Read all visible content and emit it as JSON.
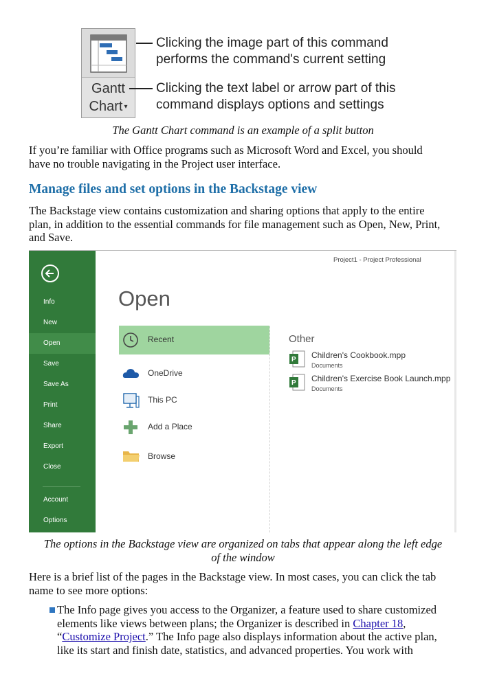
{
  "figure1": {
    "button_label_top": "Gantt",
    "button_label_bottom": "Chart",
    "callout1_line1": "Clicking the image part of this command",
    "callout1_line2": "performs the command's current setting",
    "callout2_line1": "Clicking the text label or arrow part of this",
    "callout2_line2": "command displays options and settings",
    "caption": "The Gantt Chart command is an example of a split button"
  },
  "intro": {
    "line1": "If you’re familiar with Office programs such as Microsoft Word and Excel, you should",
    "line2": "have no trouble navigating in the Project user interface."
  },
  "section": {
    "heading": "Manage files and set options in the Backstage view",
    "p_line1": "The Backstage view contains customization and sharing options that apply to the entire",
    "p_line2": "plan, in addition to the essential commands for file management such as Open, New, Print,",
    "p_line3": "and Save."
  },
  "backstage": {
    "window_title": "Project1 - Project Professional",
    "page_title": "Open",
    "nav": [
      "Info",
      "New",
      "Open",
      "Save",
      "Save As",
      "Print",
      "Share",
      "Export",
      "Close"
    ],
    "nav_bottom": [
      "Account",
      "Options"
    ],
    "active_nav": "Open",
    "locations": [
      "Recent",
      "OneDrive",
      "This PC",
      "Add a Place",
      "Browse"
    ],
    "active_location": "Recent",
    "other_heading": "Other",
    "files": [
      {
        "name": "Children's Cookbook.mpp",
        "folder": "Documents"
      },
      {
        "name": "Children's Exercise Book Launch.mpp",
        "folder": "Documents"
      }
    ],
    "accent_color": "#317a3a",
    "active_location_color": "#9fd59f"
  },
  "figure2": {
    "caption_line1": "The options in the Backstage view are organized on tabs that appear along the left edge",
    "caption_line2": "of the window"
  },
  "list_intro": {
    "line1": "Here is a brief list of the pages in the Backstage view. In most cases, you can click the tab",
    "line2": "name to see more options:"
  },
  "bullet1": {
    "line1": "The Info page gives you access to the Organizer, a feature used to share customized",
    "line2_pre": "elements like views between plans; the Organizer is described in ",
    "line2_link": "Chapter 18",
    "line2_post": ",",
    "line3_pre": "“",
    "line3_link": "Customize Project",
    "line3_post": ".” The Info page also displays information about the active plan,",
    "line4": "like its start and finish date, statistics, and advanced properties. You work with"
  }
}
